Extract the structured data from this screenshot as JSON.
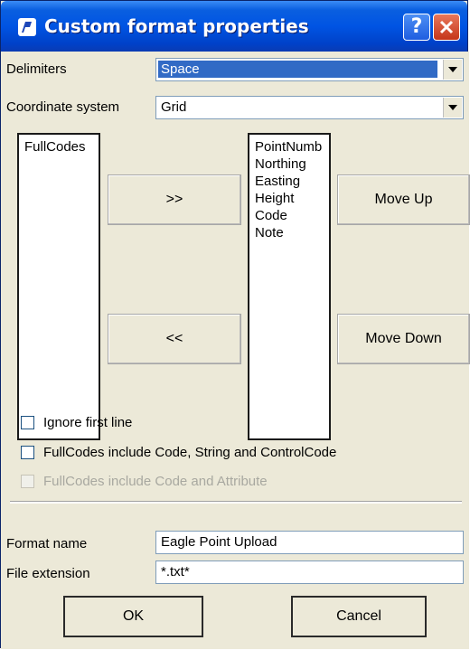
{
  "window": {
    "title": "Custom format properties",
    "help_label": "?",
    "accent": "#0054e3"
  },
  "delimiters": {
    "label": "Delimiters",
    "value": "Space"
  },
  "coordinate_system": {
    "label": "Coordinate system",
    "value": "Grid"
  },
  "available_list": {
    "items": [
      "FullCodes"
    ]
  },
  "selected_list": {
    "items": [
      "PointNumb",
      "Northing",
      "Easting",
      "Height",
      "Code",
      "Note"
    ]
  },
  "buttons": {
    "add": ">>",
    "remove": "<<",
    "move_up": "Move Up",
    "move_down": "Move Down",
    "ok": "OK",
    "cancel": "Cancel"
  },
  "options": {
    "ignore_first_line": {
      "label": "Ignore first line",
      "checked": false
    },
    "fullcodes_code_string_control": {
      "label": "FullCodes include Code, String and ControlCode",
      "checked": false
    },
    "fullcodes_code_attribute": {
      "label": "FullCodes include Code and Attribute",
      "checked": false,
      "disabled": true
    }
  },
  "format_name": {
    "label": "Format name",
    "value": "Eagle Point Upload"
  },
  "file_extension": {
    "label": "File extension",
    "value": "*.txt*"
  }
}
